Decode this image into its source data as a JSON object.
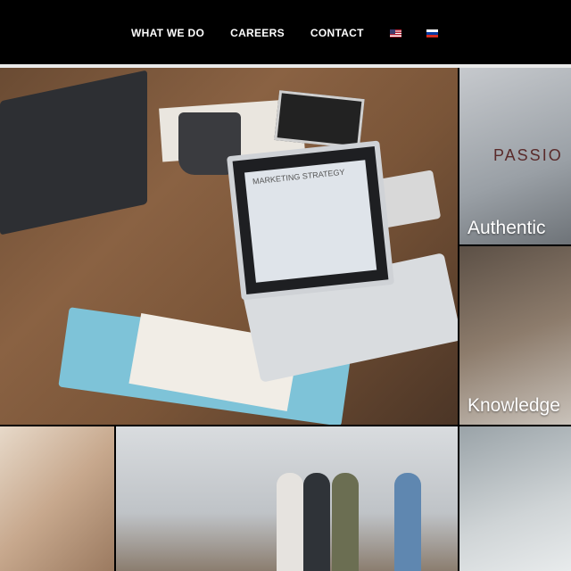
{
  "nav": {
    "items": [
      {
        "label": "WHAT WE DO"
      },
      {
        "label": "CAREERS"
      },
      {
        "label": "CONTACT"
      }
    ],
    "flags": [
      {
        "icon": "us-flag-icon"
      },
      {
        "icon": "ru-flag-icon"
      }
    ]
  },
  "tiles": {
    "hero": {
      "screen_text": "MARKETING STRATEGY"
    },
    "side1": {
      "label": "Authentic",
      "sign_text": "PASSIO"
    },
    "side2": {
      "label": "Knowledge"
    }
  },
  "colors": {
    "topbar": "#000000",
    "divider": "#e9e9e9",
    "label": "#ffffff"
  }
}
